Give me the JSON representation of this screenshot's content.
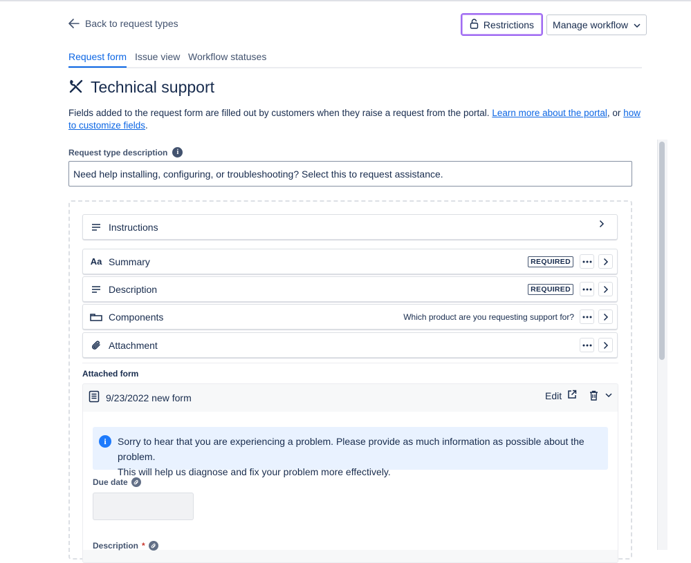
{
  "header": {
    "back_label": "Back to request types",
    "restrictions_label": "Restrictions",
    "manage_workflow_label": "Manage workflow"
  },
  "tabs": [
    {
      "label": "Request form",
      "active": true
    },
    {
      "label": "Issue view",
      "active": false
    },
    {
      "label": "Workflow statuses",
      "active": false
    }
  ],
  "page": {
    "title": "Technical support",
    "title_icon": "tools-icon",
    "intro_text": "Fields added to the request form are filled out by customers when they raise a request from the portal. ",
    "intro_link1": "Learn more about the portal",
    "intro_mid": ", or ",
    "intro_link2": "how to customize fields",
    "intro_end": "."
  },
  "request_type_description": {
    "label": "Request type description",
    "value": "Need help installing, configuring, or troubleshooting? Select this to request assistance."
  },
  "fields": [
    {
      "label": "Instructions",
      "icon": "text-lines-icon"
    },
    {
      "label": "Summary",
      "icon": "text-style-icon",
      "badge": "REQUIRED"
    },
    {
      "label": "Description",
      "icon": "text-lines-icon",
      "badge": "REQUIRED"
    },
    {
      "label": "Components",
      "icon": "component-icon",
      "hint": "Which product are you requesting support for?"
    },
    {
      "label": "Attachment",
      "icon": "paperclip-icon"
    }
  ],
  "attached_form": {
    "section_label": "Attached form",
    "name": "9/23/2022 new form",
    "edit_label": "Edit",
    "notice_line1": "Sorry to hear that you are experiencing a problem. Please provide as much information as possible about the problem.",
    "notice_line2": "This will help us diagnose and fix your problem more effectively.",
    "due_date_label": "Due date",
    "description_label": "Description",
    "required_marker": "*"
  },
  "colors": {
    "accent": "#0c66e4",
    "restrictions_border": "#a06cf2",
    "notice_bg": "#e9f2ff"
  }
}
